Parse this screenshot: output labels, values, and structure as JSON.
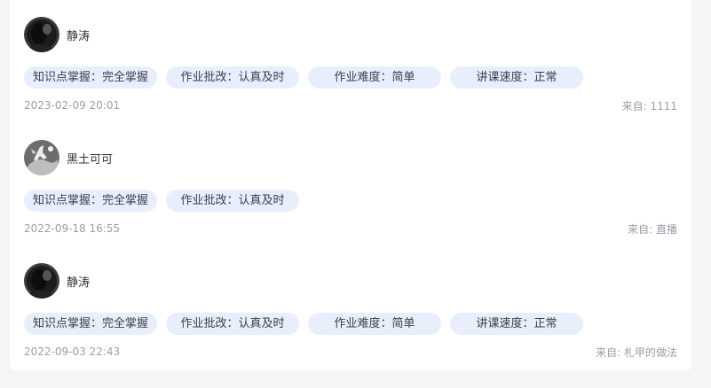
{
  "reviews": [
    {
      "username": "静涛",
      "avatar_icon": "dark-portrait-avatar",
      "tags": [
        "知识点掌握：完全掌握",
        "作业批改：认真及时",
        "作业难度：简单",
        "讲课速度：正常"
      ],
      "date": "2023-02-09 20:01",
      "source": "来自: 1111"
    },
    {
      "username": "黑土可可",
      "avatar_icon": "figure-avatar",
      "tags": [
        "知识点掌握：完全掌握",
        "作业批改：认真及时"
      ],
      "date": "2022-09-18 16:55",
      "source": "来自: 直播"
    },
    {
      "username": "静涛",
      "avatar_icon": "dark-portrait-avatar",
      "tags": [
        "知识点掌握：完全掌握",
        "作业批改：认真及时",
        "作业难度：简单",
        "讲课速度：正常"
      ],
      "date": "2022-09-03 22:43",
      "source": "来自: 札甲的做法"
    }
  ]
}
